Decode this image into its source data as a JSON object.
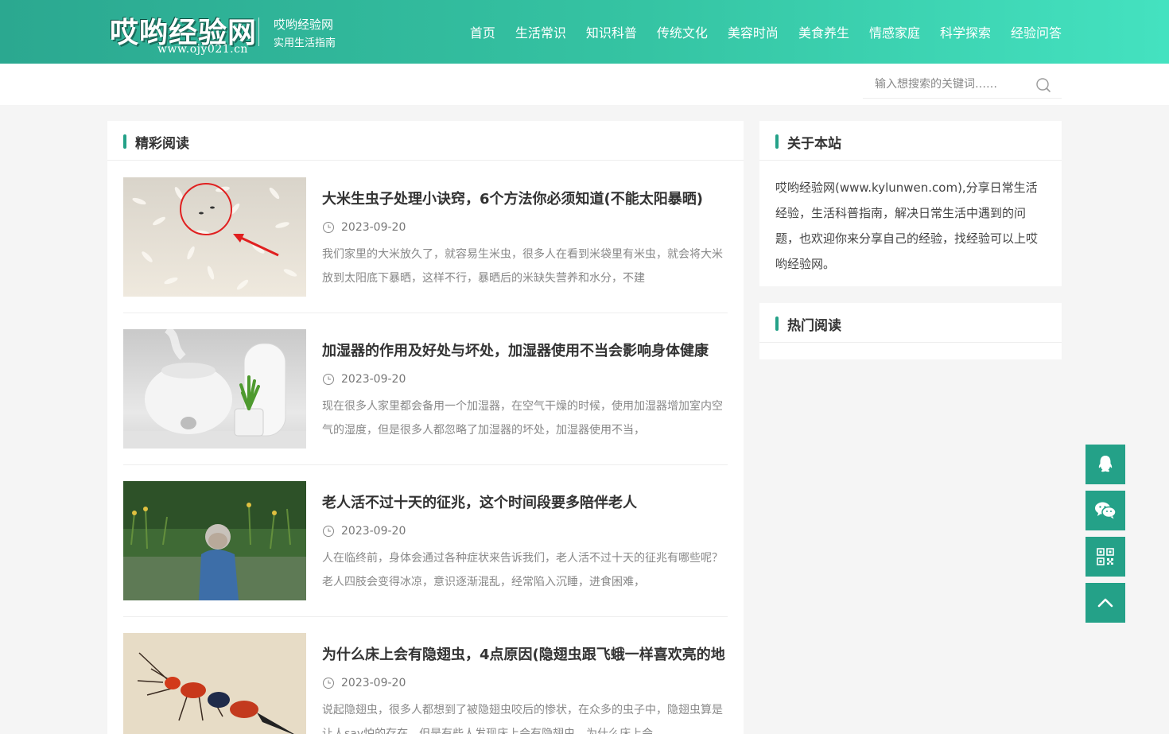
{
  "header": {
    "logo_text": "哎哟经验网",
    "logo_url": "www.ojy021.cn",
    "site_name": "哎哟经验网",
    "slogan": "实用生活指南",
    "nav": [
      "首页",
      "生活常识",
      "知识科普",
      "传统文化",
      "美容时尚",
      "美食养生",
      "情感家庭",
      "科学探索",
      "经验问答"
    ]
  },
  "search": {
    "placeholder": "输入想搜索的关键词……"
  },
  "main": {
    "section_title": "精彩阅读",
    "articles": [
      {
        "title": "大米生虫子处理小诀窍，6个方法你必须知道(不能太阳暴晒)",
        "date": "2023-09-20",
        "excerpt": "我们家里的大米放久了，就容易生米虫，很多人在看到米袋里有米虫，就会将大米放到太阳底下暴晒，这样不行，暴晒后的米缺失营养和水分，不建"
      },
      {
        "title": "加湿器的作用及好处与坏处，加湿器使用不当会影响身体健康",
        "date": "2023-09-20",
        "excerpt": "现在很多人家里都会备用一个加湿器，在空气干燥的时候，使用加湿器增加室内空气的湿度，但是很多人都忽略了加湿器的坏处，加湿器使用不当，"
      },
      {
        "title": "老人活不过十天的征兆，这个时间段要多陪伴老人",
        "date": "2023-09-20",
        "excerpt": "人在临终前，身体会通过各种症状来告诉我们，老人活不过十天的征兆有哪些呢？老人四肢会变得冰凉，意识逐渐混乱，经常陷入沉睡，进食困难，"
      },
      {
        "title": "为什么床上会有隐翅虫，4点原因(隐翅虫跟飞蛾一样喜欢亮的地",
        "date": "2023-09-20",
        "excerpt": "说起隐翅虫，很多人都想到了被隐翅虫咬后的惨状，在众多的虫子中，隐翅虫算是让人say怕的存在，但是有些人发现床上会有隐翅虫，为什么床上会"
      }
    ]
  },
  "sidebar": {
    "about_title": "关于本站",
    "about_text": "哎哟经验网(www.kylunwen.com),分享日常生活经验，生活科普指南，解决日常生活中遇到的问题，也欢迎你来分享自己的经验，找经验可以上哎哟经验网。",
    "hot_title": "热门阅读"
  },
  "float_buttons": [
    "qq-icon",
    "wechat-icon",
    "qrcode-icon",
    "back-to-top-icon"
  ]
}
